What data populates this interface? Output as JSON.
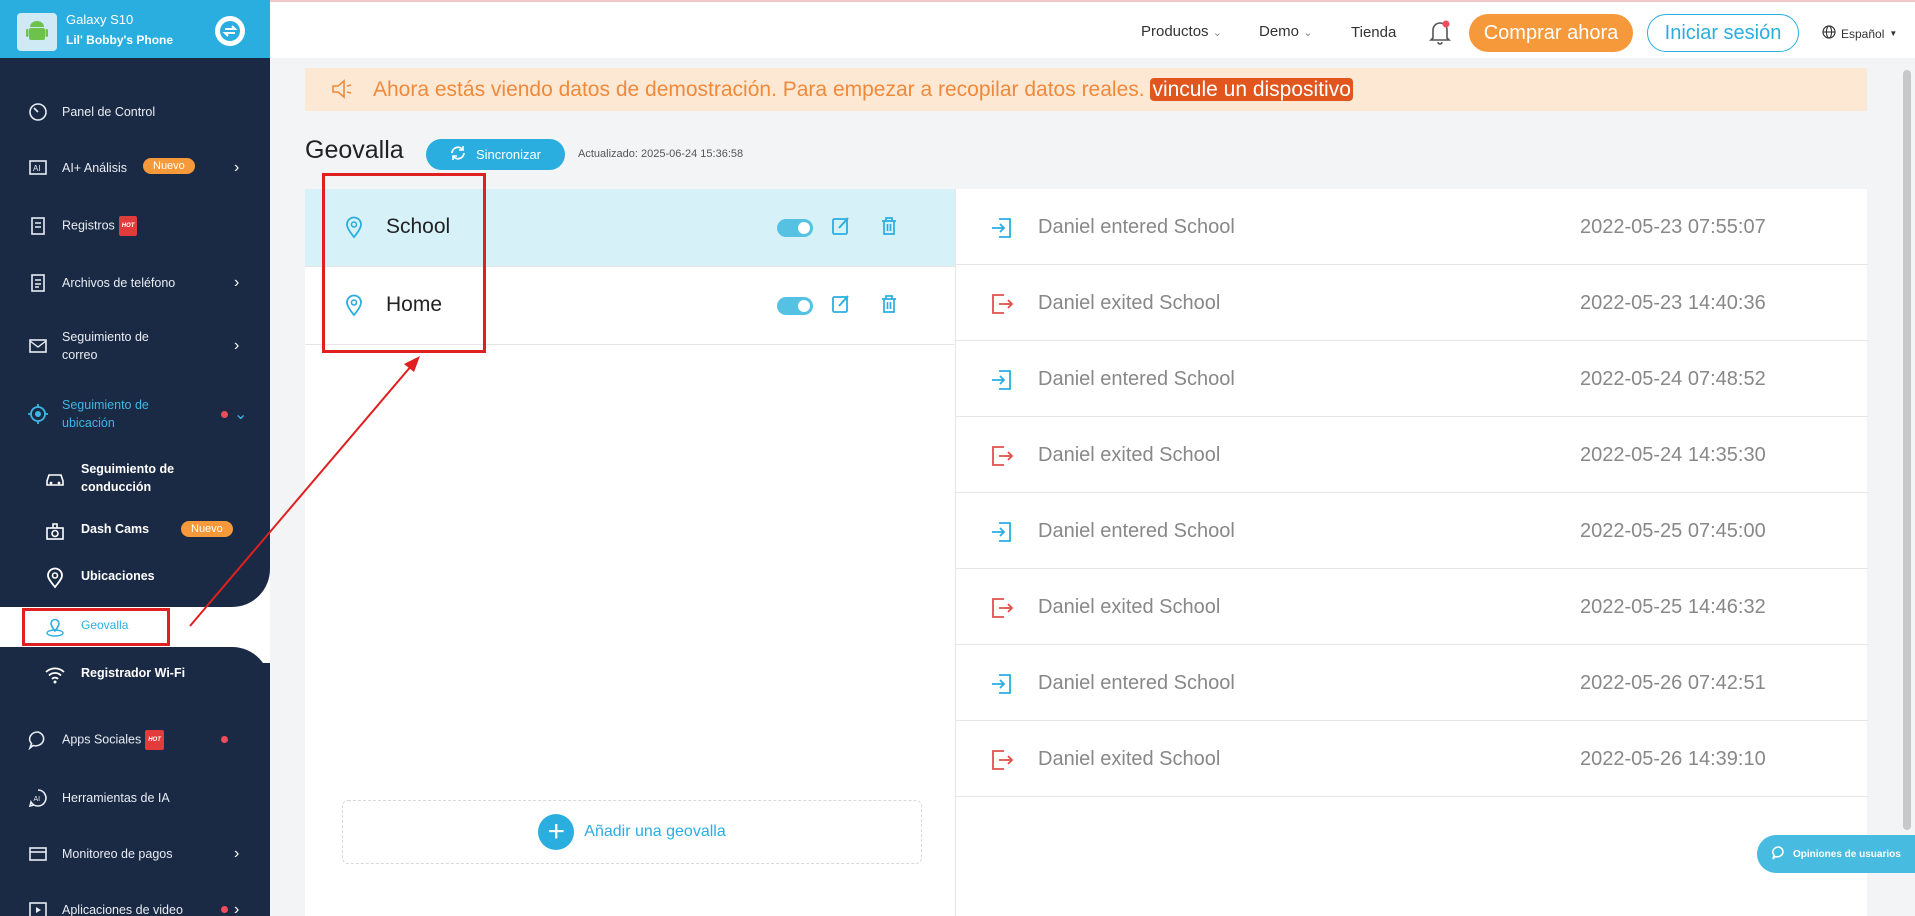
{
  "device": {
    "model": "Galaxy S10",
    "name": "Lil' Bobby's Phone"
  },
  "sidebar": {
    "items": [
      {
        "label": "Panel de Control",
        "icon": "speedometer-icon"
      },
      {
        "label": "AI+ Análisis",
        "badge": "Nuevo",
        "icon": "ai-icon"
      },
      {
        "label": "Registros",
        "hot": "HOT",
        "icon": "log-icon"
      },
      {
        "label": "Archivos de teléfono",
        "icon": "file-icon"
      },
      {
        "label_line1": "Seguimiento de",
        "label_line2": "correo",
        "icon": "mail-icon"
      },
      {
        "label_line1": "Seguimiento de",
        "label_line2": "ubicación",
        "icon": "location-target-icon"
      },
      {
        "label": "Apps Sociales",
        "hot": "HOT",
        "icon": "chat-icon"
      },
      {
        "label": "Herramientas de IA",
        "icon": "ai-tools-icon"
      },
      {
        "label": "Monitoreo de pagos",
        "icon": "payment-icon"
      },
      {
        "label": "Aplicaciones de video",
        "icon": "video-icon"
      }
    ],
    "sub_items": [
      {
        "label_line1": "Seguimiento de",
        "label_line2": "conducción",
        "icon": "car-icon"
      },
      {
        "label": "Dash Cams",
        "badge": "Nuevo",
        "icon": "dashcam-icon"
      },
      {
        "label": "Ubicaciones",
        "icon": "pin-icon"
      },
      {
        "label": "Geovalla",
        "icon": "geofence-icon"
      },
      {
        "label": "Registrador Wi-Fi",
        "icon": "wifi-icon"
      }
    ]
  },
  "topbar": {
    "productos": "Productos",
    "demo": "Demo",
    "tienda": "Tienda",
    "buy": "Comprar ahora",
    "login": "Iniciar sesión",
    "language": "Español"
  },
  "banner": {
    "text": "Ahora estás viendo datos de demostración. Para empezar a recopilar datos reales. ",
    "link": "vincule un dispositivo"
  },
  "page": {
    "title": "Geovalla",
    "sync": "Sincronizar",
    "updated": "Actualizado: 2025-06-24 15:36:58",
    "add_geofence": "Añadir una geovalla"
  },
  "geofences": [
    {
      "name": "School",
      "enabled": true,
      "selected": true
    },
    {
      "name": "Home",
      "enabled": true,
      "selected": false
    }
  ],
  "events": [
    {
      "text": "Daniel entered School",
      "time": "2022-05-23 07:55:07",
      "type": "enter"
    },
    {
      "text": "Daniel exited School",
      "time": "2022-05-23 14:40:36",
      "type": "exit"
    },
    {
      "text": "Daniel entered School",
      "time": "2022-05-24 07:48:52",
      "type": "enter"
    },
    {
      "text": "Daniel exited School",
      "time": "2022-05-24 14:35:30",
      "type": "exit"
    },
    {
      "text": "Daniel entered School",
      "time": "2022-05-25 07:45:00",
      "type": "enter"
    },
    {
      "text": "Daniel exited School",
      "time": "2022-05-25 14:46:32",
      "type": "exit"
    },
    {
      "text": "Daniel entered School",
      "time": "2022-05-26 07:42:51",
      "type": "enter"
    },
    {
      "text": "Daniel exited School",
      "time": "2022-05-26 14:39:10",
      "type": "exit"
    }
  ],
  "feedback": "Opiniones de usuarios",
  "colors": {
    "accent": "#2aaee0",
    "sidebar": "#1b2a44",
    "orange": "#f5993a",
    "annotation": "#e02020"
  }
}
